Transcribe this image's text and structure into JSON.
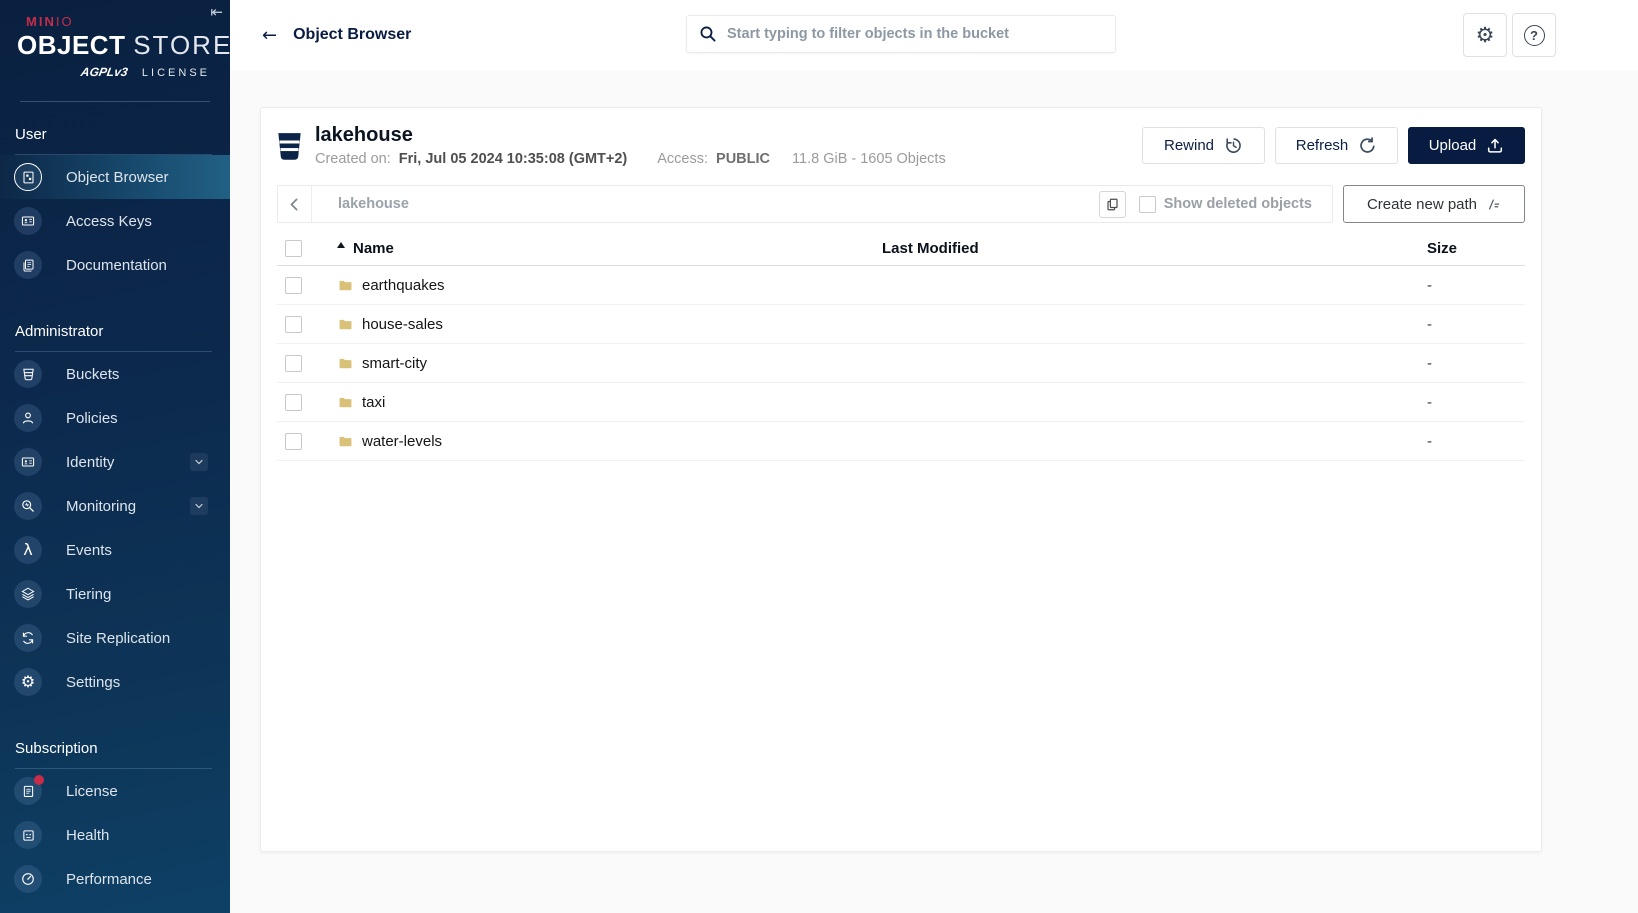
{
  "colors": {
    "accent_red": "#c72c48",
    "navy": "#081c42",
    "folder_tan": "#d9c178",
    "sidebar_top": "#0a2040",
    "sidebar_bottom": "#0e4066"
  },
  "sidebar": {
    "brand": {
      "mini": "MIN",
      "io": "IO",
      "title_bold": "OBJECT",
      "title_light": "STORE",
      "license_badge": "AGPLv3",
      "license_word": "LICENSE"
    },
    "collapse_glyph": "⇤",
    "sections": [
      {
        "label": "User",
        "items": [
          {
            "label": "Object Browser",
            "icon": "object-browser-icon",
            "active": true
          },
          {
            "label": "Access Keys",
            "icon": "access-keys-icon"
          },
          {
            "label": "Documentation",
            "icon": "documentation-icon"
          }
        ]
      },
      {
        "label": "Administrator",
        "items": [
          {
            "label": "Buckets",
            "icon": "buckets-icon"
          },
          {
            "label": "Policies",
            "icon": "policies-icon"
          },
          {
            "label": "Identity",
            "icon": "identity-icon",
            "expandable": true
          },
          {
            "label": "Monitoring",
            "icon": "monitoring-icon",
            "expandable": true
          },
          {
            "label": "Events",
            "icon": "events-icon"
          },
          {
            "label": "Tiering",
            "icon": "tiering-icon"
          },
          {
            "label": "Site Replication",
            "icon": "site-replication-icon"
          },
          {
            "label": "Settings",
            "icon": "settings-icon"
          }
        ]
      },
      {
        "label": "Subscription",
        "items": [
          {
            "label": "License",
            "icon": "license-icon",
            "badge": true
          },
          {
            "label": "Health",
            "icon": "health-icon"
          },
          {
            "label": "Performance",
            "icon": "performance-icon"
          }
        ]
      }
    ]
  },
  "header": {
    "back_glyph": "←",
    "title": "Object Browser",
    "search_placeholder": "Start typing to filter objects in the bucket"
  },
  "bucket": {
    "name": "lakehouse",
    "created_label": "Created on:",
    "created_value": "Fri, Jul 05 2024 10:35:08 (GMT+2)",
    "access_label": "Access:",
    "access_value": "PUBLIC",
    "summary": "11.8 GiB - 1605 Objects",
    "rewind_label": "Rewind",
    "refresh_label": "Refresh",
    "upload_label": "Upload"
  },
  "pathbar": {
    "path": "lakehouse",
    "show_deleted_label": "Show deleted objects",
    "create_path_label": "Create new path"
  },
  "table": {
    "columns": [
      "Name",
      "Last Modified",
      "Size"
    ],
    "rows": [
      {
        "name": "earthquakes",
        "last_modified": "",
        "size": "-"
      },
      {
        "name": "house-sales",
        "last_modified": "",
        "size": "-"
      },
      {
        "name": "smart-city",
        "last_modified": "",
        "size": "-"
      },
      {
        "name": "taxi",
        "last_modified": "",
        "size": "-"
      },
      {
        "name": "water-levels",
        "last_modified": "",
        "size": "-"
      }
    ]
  }
}
